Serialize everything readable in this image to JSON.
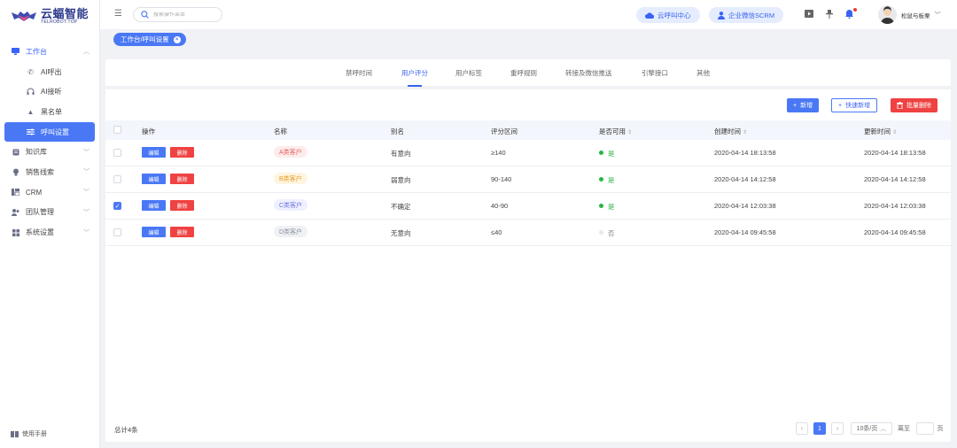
{
  "brand": {
    "name_cn": "云蝠智能",
    "name_en": "TELROBOT.TOP"
  },
  "sidebar": {
    "items": [
      {
        "label": "工作台",
        "icon": "monitor-icon"
      },
      {
        "label": "AI呼出",
        "icon": "phone-icon"
      },
      {
        "label": "AI接听",
        "icon": "headset-icon"
      },
      {
        "label": "黑名单",
        "icon": "warning-icon"
      },
      {
        "label": "呼叫设置",
        "icon": "sliders-icon"
      },
      {
        "label": "知识库",
        "icon": "book-icon"
      },
      {
        "label": "销售线索",
        "icon": "bulb-icon"
      },
      {
        "label": "CRM",
        "icon": "crm-icon"
      },
      {
        "label": "团队管理",
        "icon": "team-icon"
      },
      {
        "label": "系统设置",
        "icon": "settings-grid-icon"
      }
    ],
    "manual": "使用手册"
  },
  "header": {
    "search_placeholder": "搜索操作菜单",
    "cloud_center": "云呼叫中心",
    "scrm": "企业微信SCRM",
    "user_name": "松鼠与板栗"
  },
  "breadcrumb_tag": "工作台/呼叫设置",
  "tabs": [
    "禁呼时间",
    "用户评分",
    "用户标签",
    "重呼规则",
    "转接及微信推送",
    "引擎接口",
    "其他"
  ],
  "active_tab": "用户评分",
  "toolbar": {
    "add": "新增",
    "quick_add": "快速新增",
    "batch_delete": "批量删除"
  },
  "table": {
    "columns": [
      "操作",
      "名称",
      "别名",
      "评分区间",
      "是否可用",
      "创建时间",
      "更新时间"
    ],
    "edit_label": "编辑",
    "delete_label": "删除",
    "rows": [
      {
        "name": "A类客户",
        "alias": "有意向",
        "range": "≥140",
        "enabled": "是",
        "created": "2020-04-14  18:13:58",
        "updated": "2020-04-14  18:13:58",
        "checked": false
      },
      {
        "name": "B类客户",
        "alias": "弱意向",
        "range": "90-140",
        "enabled": "是",
        "created": "2020-04-14  14:12:58",
        "updated": "2020-04-14  14:12:58",
        "checked": false
      },
      {
        "name": "C类客户",
        "alias": "不确定",
        "range": "40-90",
        "enabled": "是",
        "created": "2020-04-14  12:03:38",
        "updated": "2020-04-14  12:03:38",
        "checked": true
      },
      {
        "name": "D类客户",
        "alias": "无意向",
        "range": "≤40",
        "enabled": "否",
        "created": "2020-04-14  09:45:58",
        "updated": "2020-04-14  09:45:58",
        "checked": false
      }
    ]
  },
  "footer": {
    "total": "总计4条",
    "current_page": "1",
    "page_size": "10条/页",
    "goto_label": "离至",
    "page_unit": "页"
  },
  "colors": {
    "primary": "#4a78f5",
    "danger": "#ef4242",
    "success": "#27b543"
  }
}
